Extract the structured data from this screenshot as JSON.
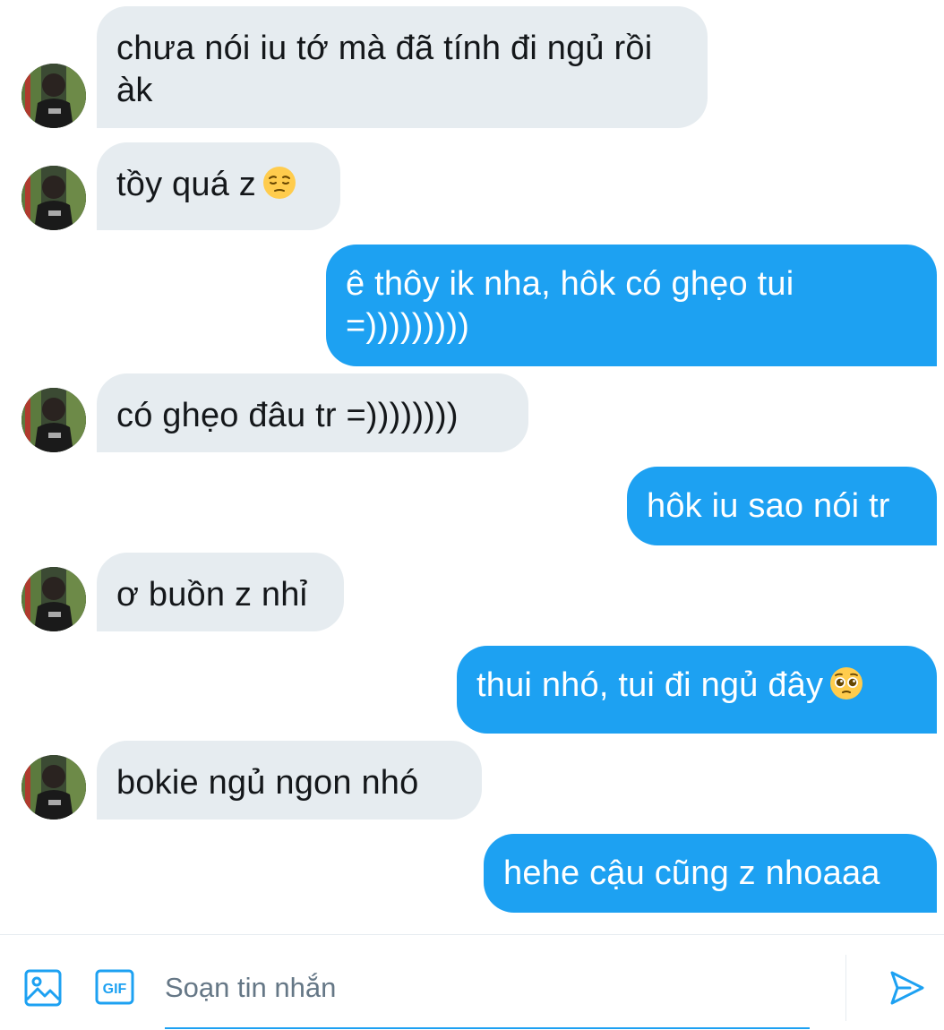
{
  "messages": [
    {
      "side": "in",
      "text": "chưa nói iu tớ mà đã tính đi ngủ rồi àk"
    },
    {
      "side": "in",
      "text": "tồy quá z",
      "emoji": "pensive-face"
    },
    {
      "side": "out",
      "text": "ê thôy ik nha, hôk có ghẹo tui =)))))))))"
    },
    {
      "side": "in",
      "text": "có ghẹo đâu tr =))))))))"
    },
    {
      "side": "out",
      "text": "hôk iu sao nói tr"
    },
    {
      "side": "in",
      "text": "ơ buồn z nhỉ"
    },
    {
      "side": "out",
      "text": "thui nhó, tui đi ngủ đây",
      "emoji": "pleading-face"
    },
    {
      "side": "in",
      "text": "bokie ngủ ngon nhó"
    },
    {
      "side": "out",
      "text": "hehe cậu cũng z nhoaaa"
    }
  ],
  "composer": {
    "placeholder": "Soạn tin nhắn",
    "media_icon": "image-icon",
    "gif_icon": "gif-icon",
    "gif_label": "GIF",
    "send_icon": "send-icon"
  },
  "colors": {
    "incoming_bubble": "#e6ecf0",
    "outgoing_bubble": "#1da1f2",
    "accent": "#1da1f2",
    "incoming_text": "#14171a",
    "placeholder_text": "#657786"
  }
}
